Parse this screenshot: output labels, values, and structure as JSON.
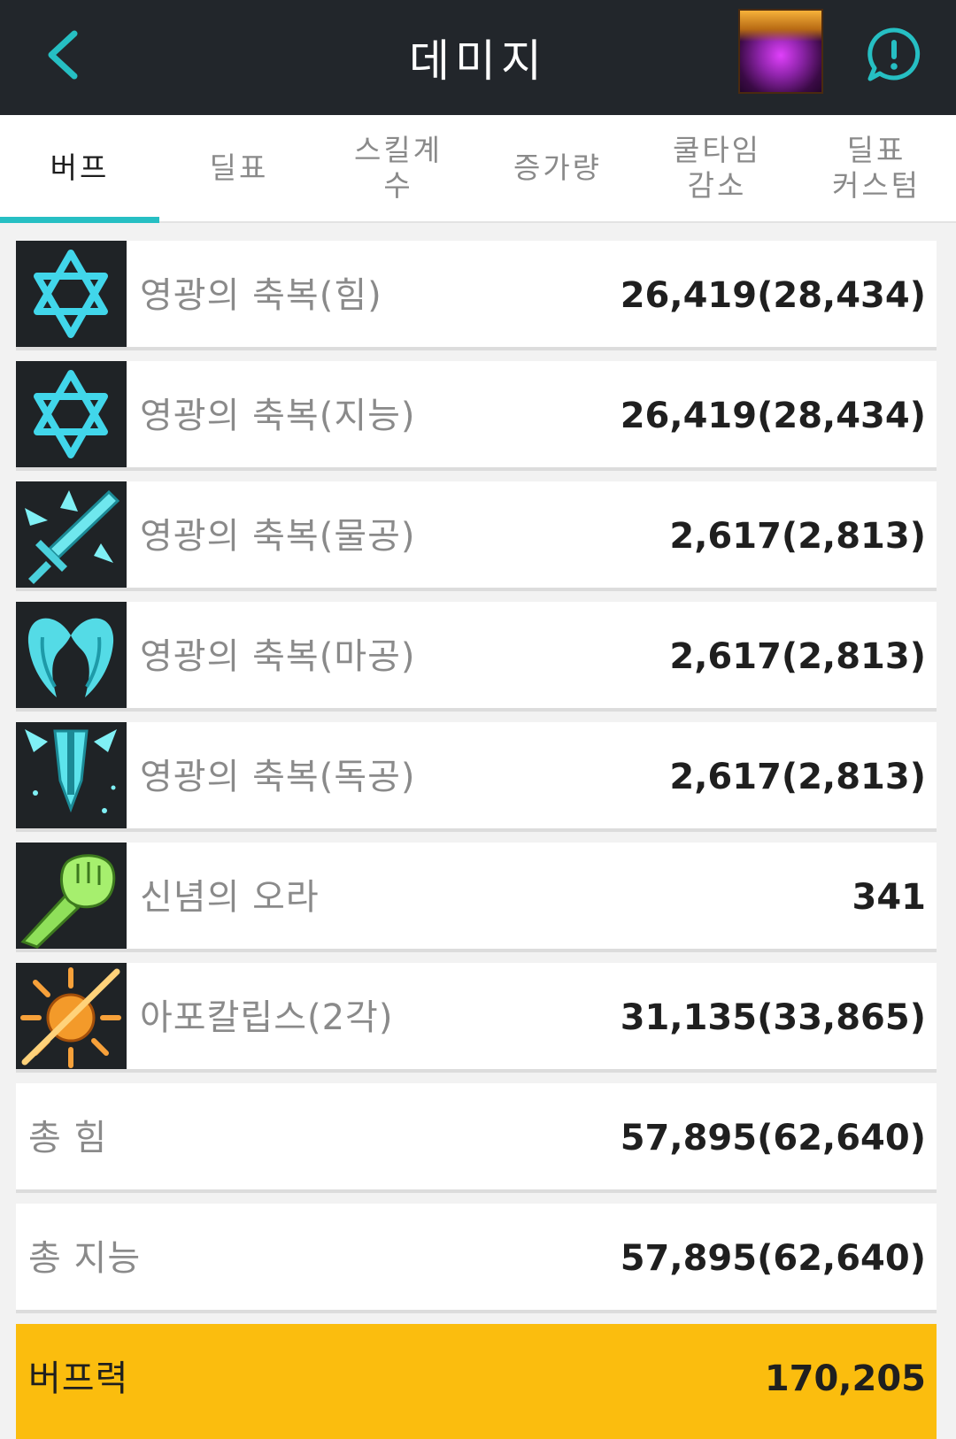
{
  "header": {
    "title": "데미지",
    "back_icon": "back-chevron-icon",
    "alert_icon": "alert-chat-icon",
    "accent_color": "#26bfc3"
  },
  "tabs": [
    {
      "label": "버프",
      "active": true
    },
    {
      "label": "딜표",
      "active": false
    },
    {
      "label": "스킬계\n수",
      "active": false
    },
    {
      "label": "증가량",
      "active": false
    },
    {
      "label": "쿨타임\n감소",
      "active": false
    },
    {
      "label": "딜표\n커스텀",
      "active": false
    }
  ],
  "buffs": [
    {
      "name": "영광의 축복(힘)",
      "value": "26,419(28,434)",
      "icon": "hexagram-icon"
    },
    {
      "name": "영광의 축복(지능)",
      "value": "26,419(28,434)",
      "icon": "hexagram-icon"
    },
    {
      "name": "영광의 축복(물공)",
      "value": "2,617(2,813)",
      "icon": "sword-icon"
    },
    {
      "name": "영광의 축복(마공)",
      "value": "2,617(2,813)",
      "icon": "wings-icon"
    },
    {
      "name": "영광의 축복(독공)",
      "value": "2,617(2,813)",
      "icon": "dagger-icon"
    },
    {
      "name": "신념의 오라",
      "value": "341",
      "icon": "fist-icon"
    },
    {
      "name": "아포칼립스(2각)",
      "value": "31,135(33,865)",
      "icon": "sun-icon"
    }
  ],
  "totals": [
    {
      "name": "총 힘",
      "value": "57,895(62,640)"
    },
    {
      "name": "총 지능",
      "value": "57,895(62,640)"
    }
  ],
  "grand_total": {
    "name": "버프력",
    "value": "170,205",
    "color": "#fbbd0e"
  }
}
